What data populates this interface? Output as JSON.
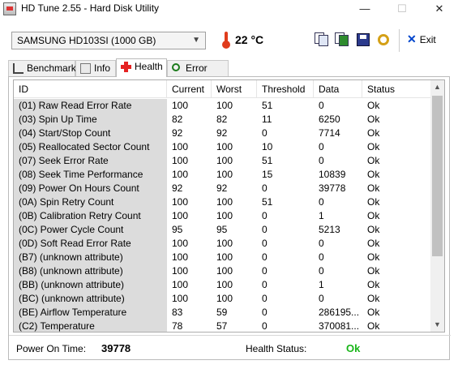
{
  "window": {
    "title": "HD Tune 2.55 - Hard Disk Utility",
    "minimize": "—",
    "maximize": "☐",
    "close": "✕"
  },
  "toolbar": {
    "drive": "SAMSUNG HD103SI (1000 GB)",
    "temperature": "22 °C",
    "icons": [
      "copy-text-icon",
      "copy-screenshot-icon",
      "save-icon",
      "options-icon"
    ],
    "exit_label": "Exit",
    "exit_icon": "exit-icon"
  },
  "tabs": [
    {
      "label": "Benchmark",
      "icon": "benchmark-icon",
      "active": false
    },
    {
      "label": "Info",
      "icon": "info-icon",
      "active": false
    },
    {
      "label": "Health",
      "icon": "health-icon",
      "active": true
    },
    {
      "label": "Error Scan",
      "icon": "error-scan-icon",
      "active": false
    }
  ],
  "table": {
    "columns": [
      "ID",
      "Current",
      "Worst",
      "Threshold",
      "Data",
      "Status"
    ],
    "rows": [
      [
        "(01) Raw Read Error Rate",
        "100",
        "100",
        "51",
        "0",
        "Ok"
      ],
      [
        "(03) Spin Up Time",
        "82",
        "82",
        "11",
        "6250",
        "Ok"
      ],
      [
        "(04) Start/Stop Count",
        "92",
        "92",
        "0",
        "7714",
        "Ok"
      ],
      [
        "(05) Reallocated Sector Count",
        "100",
        "100",
        "10",
        "0",
        "Ok"
      ],
      [
        "(07) Seek Error Rate",
        "100",
        "100",
        "51",
        "0",
        "Ok"
      ],
      [
        "(08) Seek Time Performance",
        "100",
        "100",
        "15",
        "10839",
        "Ok"
      ],
      [
        "(09) Power On Hours Count",
        "92",
        "92",
        "0",
        "39778",
        "Ok"
      ],
      [
        "(0A) Spin Retry Count",
        "100",
        "100",
        "51",
        "0",
        "Ok"
      ],
      [
        "(0B) Calibration Retry Count",
        "100",
        "100",
        "0",
        "1",
        "Ok"
      ],
      [
        "(0C) Power Cycle Count",
        "95",
        "95",
        "0",
        "5213",
        "Ok"
      ],
      [
        "(0D) Soft Read Error Rate",
        "100",
        "100",
        "0",
        "0",
        "Ok"
      ],
      [
        "(B7) (unknown attribute)",
        "100",
        "100",
        "0",
        "0",
        "Ok"
      ],
      [
        "(B8) (unknown attribute)",
        "100",
        "100",
        "0",
        "0",
        "Ok"
      ],
      [
        "(BB) (unknown attribute)",
        "100",
        "100",
        "0",
        "1",
        "Ok"
      ],
      [
        "(BC) (unknown attribute)",
        "100",
        "100",
        "0",
        "0",
        "Ok"
      ],
      [
        "(BE) Airflow Temperature",
        "83",
        "59",
        "0",
        "286195...",
        "Ok"
      ],
      [
        "(C2) Temperature",
        "78",
        "57",
        "0",
        "370081...",
        "Ok"
      ]
    ]
  },
  "footer": {
    "power_on_label": "Power On Time:",
    "power_on_value": "39778",
    "health_label": "Health Status:",
    "health_value": "Ok"
  },
  "colors": {
    "ok_green": "#18b518",
    "id_column_bg": "#dcdcdc",
    "thermometer": "#e03c1c"
  }
}
